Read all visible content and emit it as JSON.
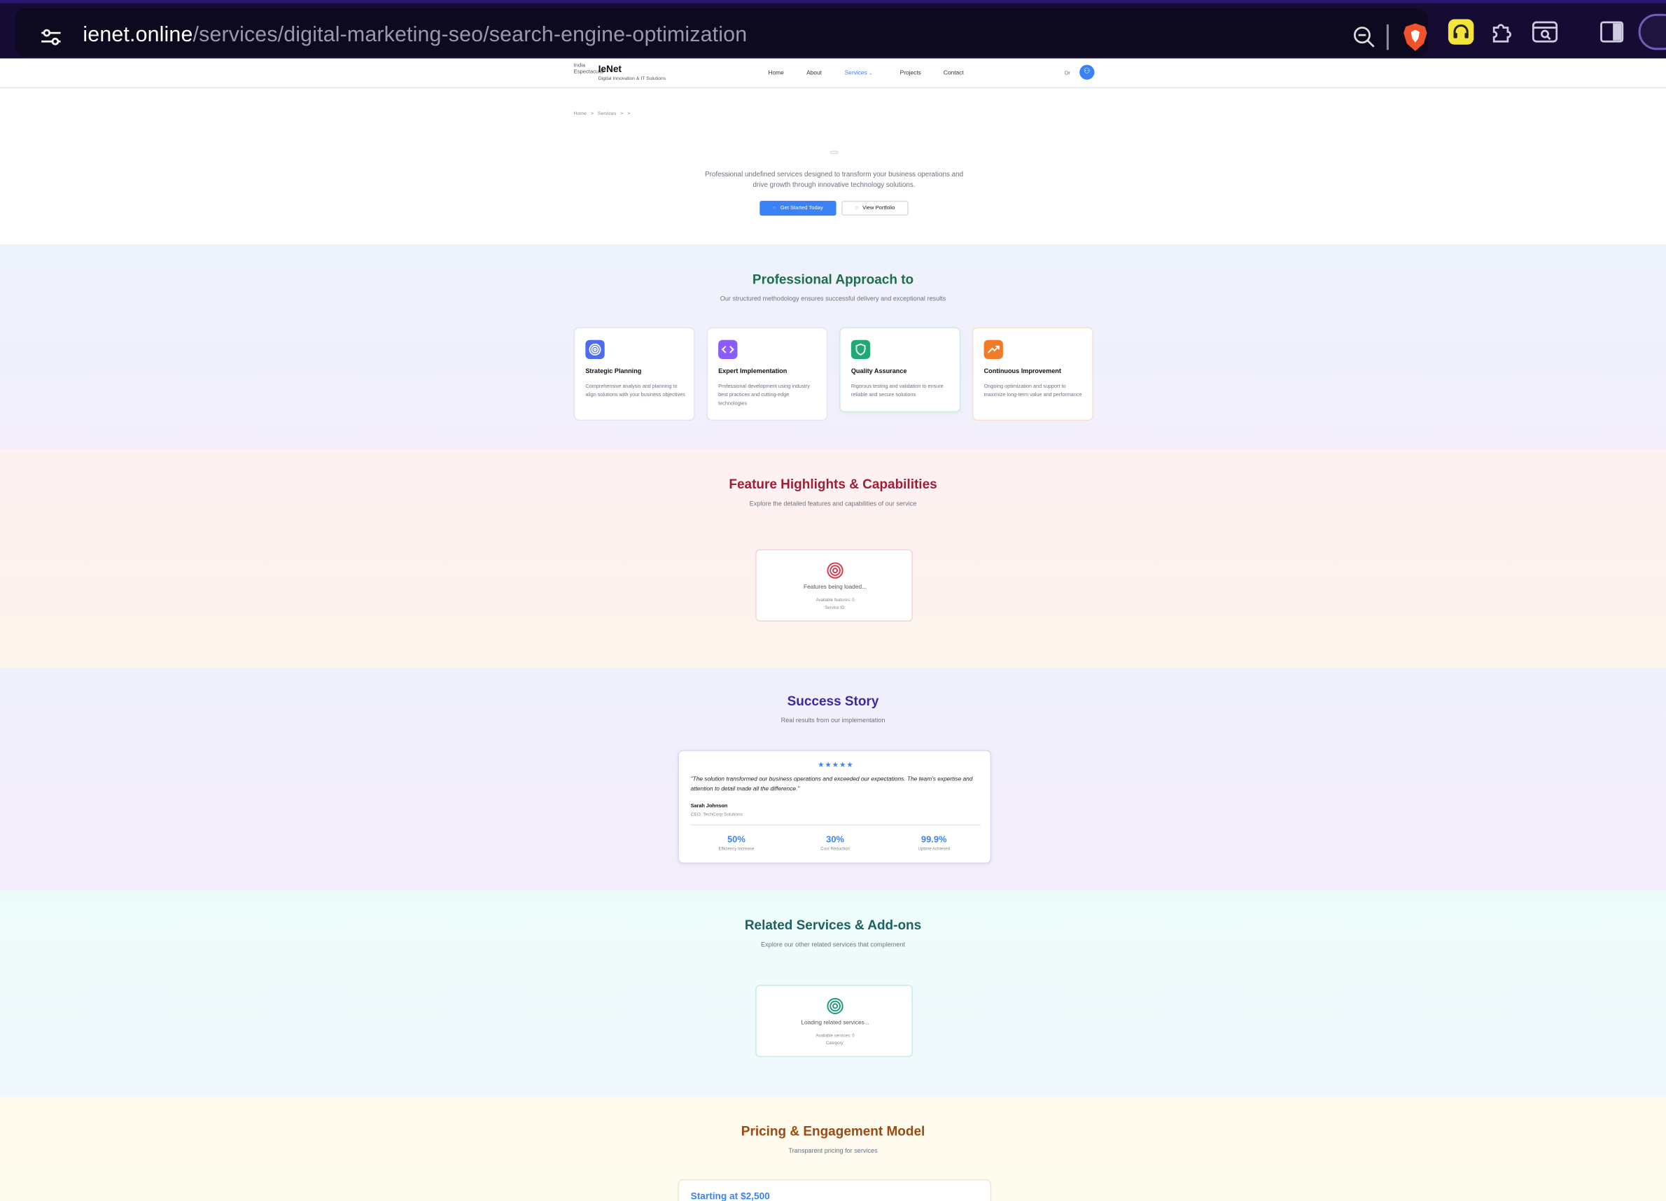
{
  "browser": {
    "url_host": "ienet.online",
    "url_path": "/services/digital-marketing-seo/search-engine-optimization"
  },
  "nav": {
    "logo_alt": "India Espectacular",
    "brand": "IeNet",
    "tagline": "Digital Innovation & IT Solutions",
    "links": [
      "Home",
      "About",
      "Services",
      "Projects",
      "Contact"
    ],
    "active": "Services",
    "lang": "Dr"
  },
  "breadcrumb": [
    "Home",
    ">",
    "Services",
    ">",
    ">"
  ],
  "hero": {
    "description": "Professional undefined services designed to transform your business operations and drive growth through innovative technology solutions.",
    "primary_button": "Get Started Today",
    "secondary_button": "View Portfolio"
  },
  "approach": {
    "title": "Professional Approach to",
    "subtitle": "Our structured methodology ensures successful delivery and exceptional results",
    "cards": [
      {
        "title": "Strategic Planning",
        "desc": "Comprehensive analysis and planning to align solutions with your business objectives",
        "color": "#4f6cf0"
      },
      {
        "title": "Expert Implementation",
        "desc": "Professional development using industry best practices and cutting-edge technologies",
        "color": "#8b5cf6"
      },
      {
        "title": "Quality Assurance",
        "desc": "Rigorous testing and validation to ensure reliable and secure solutions",
        "color": "#22a874"
      },
      {
        "title": "Continuous Improvement",
        "desc": "Ongoing optimization and support to maximize long-term value and performance",
        "color": "#f07c2a"
      }
    ]
  },
  "features": {
    "title": "Feature Highlights & Capabilities",
    "subtitle": "Explore the detailed features and capabilities of our service",
    "loading": "Features being loaded...",
    "meta1": "Available features: 0",
    "meta2": "Service ID:"
  },
  "success": {
    "title": "Success Story",
    "subtitle": "Real results from our implementation",
    "stars": "★★★★★",
    "quote": "\"The solution transformed our business operations and exceeded our expectations. The team's expertise and attention to detail made all the difference.\"",
    "author": "Sarah Johnson",
    "role": "CEO, TechCorp Solutions",
    "stats": [
      {
        "value": "50%",
        "label": "Efficiency Increase"
      },
      {
        "value": "30%",
        "label": "Cost Reduction"
      },
      {
        "value": "99.9%",
        "label": "Uptime Achieved"
      }
    ]
  },
  "related": {
    "title": "Related Services & Add-ons",
    "subtitle": "Explore our other related services that complement",
    "loading": "Loading related services...",
    "meta1": "Available services: 0",
    "meta2": "Category:"
  },
  "pricing": {
    "title": "Pricing & Engagement Model",
    "subtitle": "Transparent pricing for services",
    "price": "Starting at $2,500"
  },
  "colors": {
    "accent": "#3b82f6",
    "approach_title": "#1f6e4a",
    "features_title": "#9f1d35",
    "success_title": "#3b2aa0",
    "related_title": "#1f6060",
    "pricing_title": "#9a4a12"
  }
}
